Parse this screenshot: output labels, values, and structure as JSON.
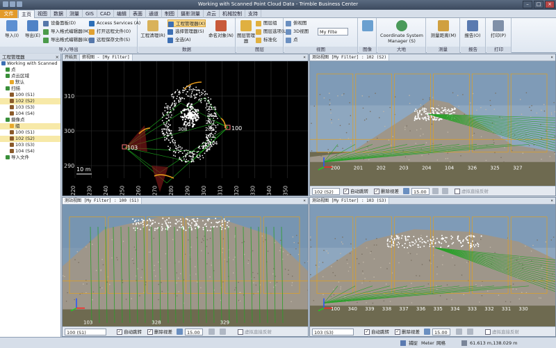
{
  "window": {
    "title": "Working with Scanned Point Cloud Data - Trimble Business Center"
  },
  "tabs": [
    "文件",
    "主页",
    "视图",
    "数据",
    "测量",
    "GIS",
    "CAD",
    "编辑",
    "表面",
    "通道",
    "制图",
    "摄影测量",
    "点云",
    "机械控制",
    "支持"
  ],
  "active_tab": "主页",
  "ribbon": {
    "import_export": {
      "label": "导入/导出",
      "import": "导入(I)",
      "export": "导出(E)",
      "items": [
        "设备面板(D)",
        "导入格式编辑器(M)",
        "导出格式编辑器(B)"
      ],
      "items2": [
        "Access Services (A)",
        "打开远程文件(O)",
        "远程保存文件(S)"
      ]
    },
    "data": {
      "label": "数据",
      "project_cleanup": "工程清理(R)",
      "items": [
        "工程管理器(X)",
        "选择管理器(S)",
        "全选(A)"
      ],
      "naming": "命名对象(N)"
    },
    "layers": {
      "label": "图层",
      "layer_manager": "图层管理器",
      "items": [
        "图层组",
        "图层选项(L)",
        "标准化"
      ]
    },
    "view": {
      "label": "视图",
      "items": [
        "俯视图",
        "3D视图",
        "点"
      ],
      "filter": "My Filte"
    },
    "image": {
      "label": "图像"
    },
    "coord": {
      "label": "大地",
      "name": "Coordinate System Manager (S)"
    },
    "measure": {
      "label": "测量",
      "name": "测量距离(M)"
    },
    "report": {
      "label": "报告",
      "name": "报告(O)"
    },
    "print": {
      "label": "打印",
      "name": "打印(P)"
    }
  },
  "project_explorer": {
    "title": "工程管理器",
    "items": [
      {
        "label": "Working with Scanned",
        "level": 0,
        "color": "#3d6fb3"
      },
      {
        "label": "点",
        "level": 1,
        "color": "#3a8f3a"
      },
      {
        "label": "点云区域",
        "level": 1,
        "color": "#3a8f3a"
      },
      {
        "label": "默认",
        "level": 2,
        "color": "#e7a82c"
      },
      {
        "label": "扫描",
        "level": 1,
        "color": "#3a8f3a"
      },
      {
        "label": "100 (S1)",
        "level": 2,
        "color": "#8a5a2b"
      },
      {
        "label": "102 (S2)",
        "level": 2,
        "color": "#8a5a2b",
        "selected": true
      },
      {
        "label": "103 (S3)",
        "level": 2,
        "color": "#8a5a2b"
      },
      {
        "label": "104 (S4)",
        "level": 2,
        "color": "#8a5a2b"
      },
      {
        "label": "摄像点",
        "level": 1,
        "color": "#3a8f3a"
      },
      {
        "label": "组",
        "level": 2,
        "color": "#e7a82c",
        "selected": true
      },
      {
        "label": "100 (S1)",
        "level": 2,
        "color": "#8a5a2b"
      },
      {
        "label": "102 (S2)",
        "level": 2,
        "color": "#8a5a2b",
        "selected": true
      },
      {
        "label": "103 (S3)",
        "level": 2,
        "color": "#8a5a2b"
      },
      {
        "label": "104 (S4)",
        "level": 2,
        "color": "#8a5a2b"
      },
      {
        "label": "导入文件",
        "level": 1,
        "color": "#3a8f3a"
      }
    ]
  },
  "plan_view": {
    "tabs": [
      "开始页",
      "俯视图 - [My Filter]"
    ],
    "scale": "10 m",
    "y_ticks": [
      "310",
      "300",
      "290"
    ],
    "x_ticks": [
      "220",
      "230",
      "240",
      "250",
      "260",
      "270",
      "280",
      "290",
      "300",
      "310",
      "320",
      "330",
      "340",
      "350"
    ],
    "stations": [
      "103",
      "100"
    ],
    "labels": [
      "213",
      "212",
      "207",
      "209",
      "102",
      "104",
      "308",
      "309"
    ]
  },
  "station_views": [
    {
      "tab": "测站视图 [My Filter] : 102 (S2)",
      "station": "102 (S2)",
      "labels": [
        "200",
        "201",
        "202",
        "203",
        "204",
        "104",
        "326",
        "325",
        "327"
      ]
    },
    {
      "tab": "测站视图 [My Filter] : 100 (S1)",
      "station": "100 (S1)",
      "labels": [
        "103",
        "328",
        "329"
      ]
    },
    {
      "tab": "测站视图 [My Filter] : 103 (S3)",
      "station": "103 (S3)",
      "labels": [
        "100",
        "340",
        "339",
        "338",
        "337",
        "336",
        "335",
        "334",
        "333",
        "332",
        "331",
        "330"
      ]
    }
  ],
  "view_controls": {
    "auto_jump": "自动跳转",
    "remove_backsight": "删除视差",
    "value": "15.00",
    "virtual_label": "虚拟直接反射"
  },
  "status": {
    "snap": "捕捉",
    "units": "Meter",
    "grid": "网格",
    "coords": "61.613 m,138.029 m"
  }
}
